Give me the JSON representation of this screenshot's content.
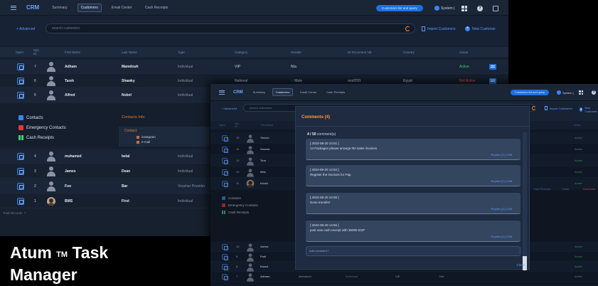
{
  "app": {
    "brand": "CRM",
    "nav": [
      "Summary",
      "Customers",
      "Email Center",
      "Cash Receipts"
    ],
    "active_nav": "Customers",
    "pill_label": "Customers list and query",
    "user_label": "System (",
    "help_glyph": "?"
  },
  "toolbar": {
    "advanced": "+ Advanced",
    "search_placeholder": "search customers",
    "import_label": "Import Customers",
    "new_label": "New Customer"
  },
  "table": {
    "headers": [
      "Open",
      "Sys. Id.",
      "First Name",
      "Last Name",
      "Type",
      "Category",
      "Gender",
      "ID Document Nb.",
      "Country",
      "Active"
    ],
    "rows_top": [
      {
        "id": "7",
        "first": "Adham",
        "last": "Mamdouh",
        "type": "Individual",
        "category": "VIP",
        "gender": "N/a",
        "doc": "",
        "country": "",
        "active": "Active",
        "active_color": "#3fd07a"
      },
      {
        "id": "6",
        "first": "Tarek",
        "last": "Shawky",
        "type": "Individual",
        "category": "National",
        "gender": "Male",
        "doc": "rest202t",
        "country": "Egypt",
        "active": "Not Active",
        "active_color": "#ff4b4b"
      },
      {
        "id": "5",
        "first": "Alfred",
        "last": "Nobel",
        "type": "Individual",
        "category": "",
        "gender": "",
        "doc": "",
        "country": "",
        "active": "",
        "active_color": "#6c778a"
      }
    ],
    "rows_bottom": [
      {
        "id": "4",
        "first": "muhamed",
        "last": "belal",
        "type": "Individual"
      },
      {
        "id": "3",
        "first": "James",
        "last": "Dean",
        "type": "Individual"
      },
      {
        "id": "2",
        "first": "Foo",
        "last": "Bar",
        "type": "Voucher Provider"
      },
      {
        "id": "1",
        "first": "BMS",
        "last": "First",
        "type": "Individual"
      }
    ],
    "records_label": "Total Records: 7"
  },
  "details": {
    "side_items": [
      "Contacts",
      "Emergency Contacts",
      "Cash Receipts"
    ],
    "contacts_info_title": "Contacts Info",
    "contact_header": "Contact",
    "contact_values": [
      "instagram",
      "e-mail"
    ]
  },
  "front_window": {
    "rows": [
      {
        "id": "15",
        "first": "Yasser",
        "active": "Active"
      },
      {
        "id": "14",
        "first": "Osama",
        "active": "Active"
      },
      {
        "id": "13",
        "first": "Tom",
        "active": "Active"
      },
      {
        "id": "12",
        "first": "Mits",
        "active": "Active"
      },
      {
        "id": "11",
        "first": "Khalo",
        "active": "Active"
      }
    ],
    "rows_lower": [
      {
        "id": "10",
        "first": "Amira",
        "active": "Active"
      },
      {
        "id": "9",
        "first": "Fadi",
        "active": "Active"
      },
      {
        "id": "8",
        "first": "Emad",
        "active": "Active"
      },
      {
        "id": "7",
        "first": "Adham",
        "last": "Mamdouh",
        "type": "Individual",
        "category": "VIP",
        "gender": "N/a",
        "active": "Active"
      }
    ],
    "actions": [
      "Cash Receipts",
      "Cards",
      "Download"
    ],
    "side_items": [
      "Contacts",
      "Emergency Contacts",
      "Cash Receipts"
    ]
  },
  "comments_modal": {
    "title": "Comments (4)",
    "count_bold": "4 / 50",
    "count_rest": " comment(s)",
    "comments": [
      {
        "date": "[ 2023-08-20 14:51 ]",
        "text": "14 Packages please arrange the sales invoices",
        "reply": "Replies (0) | Edit"
      },
      {
        "date": "[ 2023-08-20 14:52 ]",
        "text": "Register the invoices for Pap",
        "reply": "Replies (0) | Edit"
      },
      {
        "date": "[ 2023-08-20 14:55 ]",
        "text": "Done transfer!",
        "reply": "Replies (0) | Edit"
      },
      {
        "date": "[ 2023-08-20 14:55 ]",
        "text": "post new cash receipt with 35000 EGP",
        "reply": "Replies (0) | Edit"
      }
    ],
    "add_label": "Add comment *",
    "close_label": "Close"
  },
  "caption": {
    "line1": "Atum",
    "tm": "TM",
    "line1b": "Task",
    "line2": "Manager"
  },
  "colors": {
    "accent": "#3a85ff",
    "active": "#3fd07a",
    "inactive": "#ff4b4b",
    "title_orange": "#ff9a3c"
  }
}
